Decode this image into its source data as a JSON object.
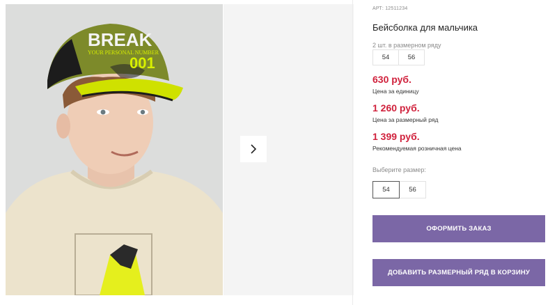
{
  "product": {
    "article": "АРТ: 12511234",
    "title": "Бейсболка для мальчика",
    "pack_info": "2 шт. в размерном ряду",
    "pack_sizes": [
      "54",
      "56"
    ]
  },
  "prices": {
    "unit_price": "630 руб.",
    "unit_label": "Цена за единицу",
    "row_price": "1 260 руб.",
    "row_label": "Цена за размерный ряд",
    "retail_price": "1 399 руб.",
    "retail_label": "Рекомендуемая розничная цена"
  },
  "size_selector": {
    "label": "Выберите размер:",
    "options": [
      "54",
      "56"
    ],
    "selected": "54"
  },
  "actions": {
    "order_label": "ОФОРМИТЬ ЗАКАЗ",
    "add_label": "ДОБАВИТЬ РАЗМЕРНЫЙ РЯД В КОРЗИНУ"
  },
  "photo": {
    "cap_text": "BREAK",
    "cap_subtext": "YOUR PERSONAL NUMBER",
    "cap_number": "001"
  },
  "colors": {
    "price": "#d0213c",
    "button": "#7b67a6",
    "cap_olive": "#7d8a2a",
    "cap_lime": "#d8f000",
    "shirt": "#ece3cc"
  },
  "icons": {
    "next": "chevron-right-icon"
  }
}
